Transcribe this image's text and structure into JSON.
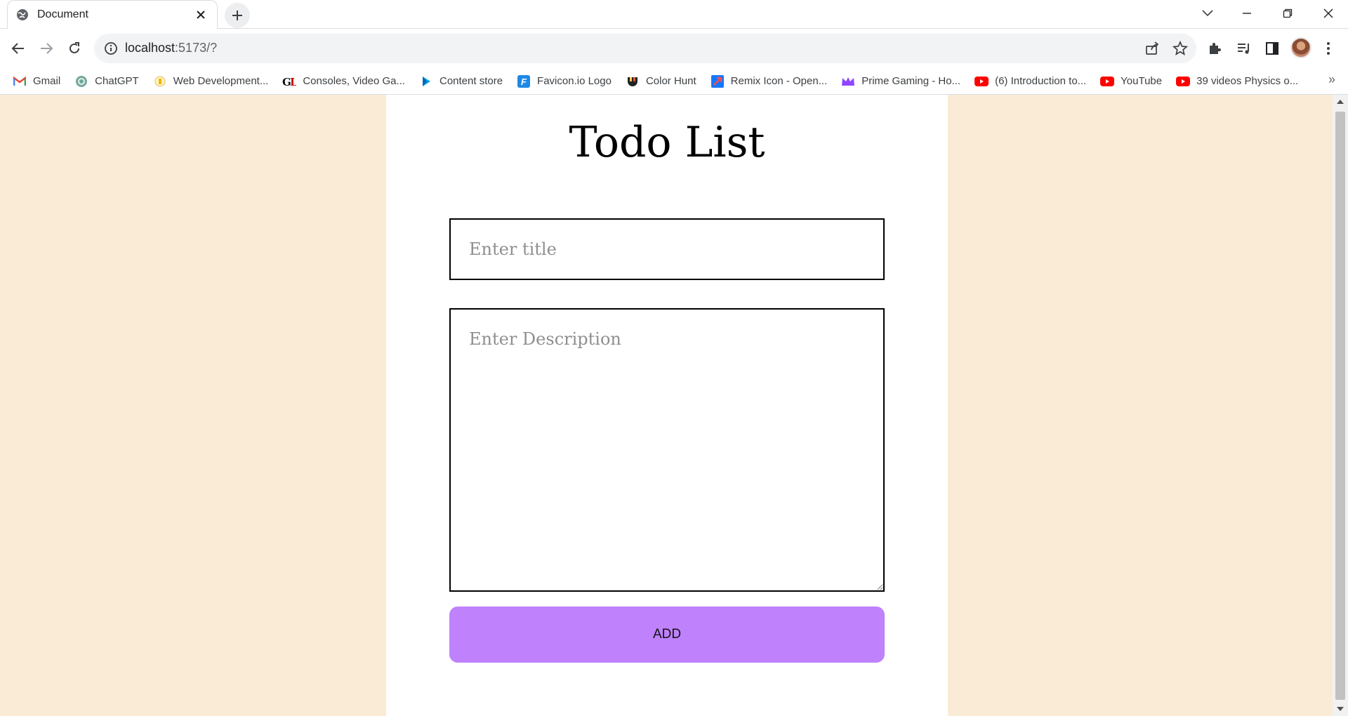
{
  "browser": {
    "tab": {
      "title": "Document",
      "favicon": "globe-icon"
    },
    "address": {
      "host": "localhost",
      "path": ":5173/?"
    },
    "bookmarks": [
      {
        "label": "Gmail",
        "icon": "gmail-icon",
        "color": "#ea4335"
      },
      {
        "label": "ChatGPT",
        "icon": "chatgpt-icon",
        "color": "#74aa9c"
      },
      {
        "label": "Web Development...",
        "icon": "webdev-icon",
        "color": "#f4b400"
      },
      {
        "label": "Consoles, Video Ga...",
        "icon": "gl-icon",
        "color": "#111111"
      },
      {
        "label": "Content store",
        "icon": "play-store-icon",
        "color": "#00a0e9"
      },
      {
        "label": "Favicon.io Logo",
        "icon": "favicon-io-icon",
        "color": "#1e88e5"
      },
      {
        "label": "Color Hunt",
        "icon": "color-hunt-icon",
        "color": "#222222"
      },
      {
        "label": "Remix Icon - Open...",
        "icon": "remix-icon",
        "color": "#1677ff"
      },
      {
        "label": "Prime Gaming - Ho...",
        "icon": "prime-gaming-icon",
        "color": "#9146ff"
      },
      {
        "label": "(6) Introduction to...",
        "icon": "youtube-icon",
        "color": "#ff0000"
      },
      {
        "label": "YouTube",
        "icon": "youtube-icon",
        "color": "#ff0000"
      },
      {
        "label": "39 videos Physics o...",
        "icon": "youtube-icon",
        "color": "#ff0000"
      }
    ],
    "more": "»"
  },
  "page": {
    "title": "Todo List",
    "title_input": {
      "placeholder": "Enter title",
      "value": ""
    },
    "description_input": {
      "placeholder": "Enter Description",
      "value": ""
    },
    "add_button": "ADD"
  },
  "colors": {
    "background": "#faebd7",
    "card": "#ffffff",
    "button": "#bf81fc"
  }
}
